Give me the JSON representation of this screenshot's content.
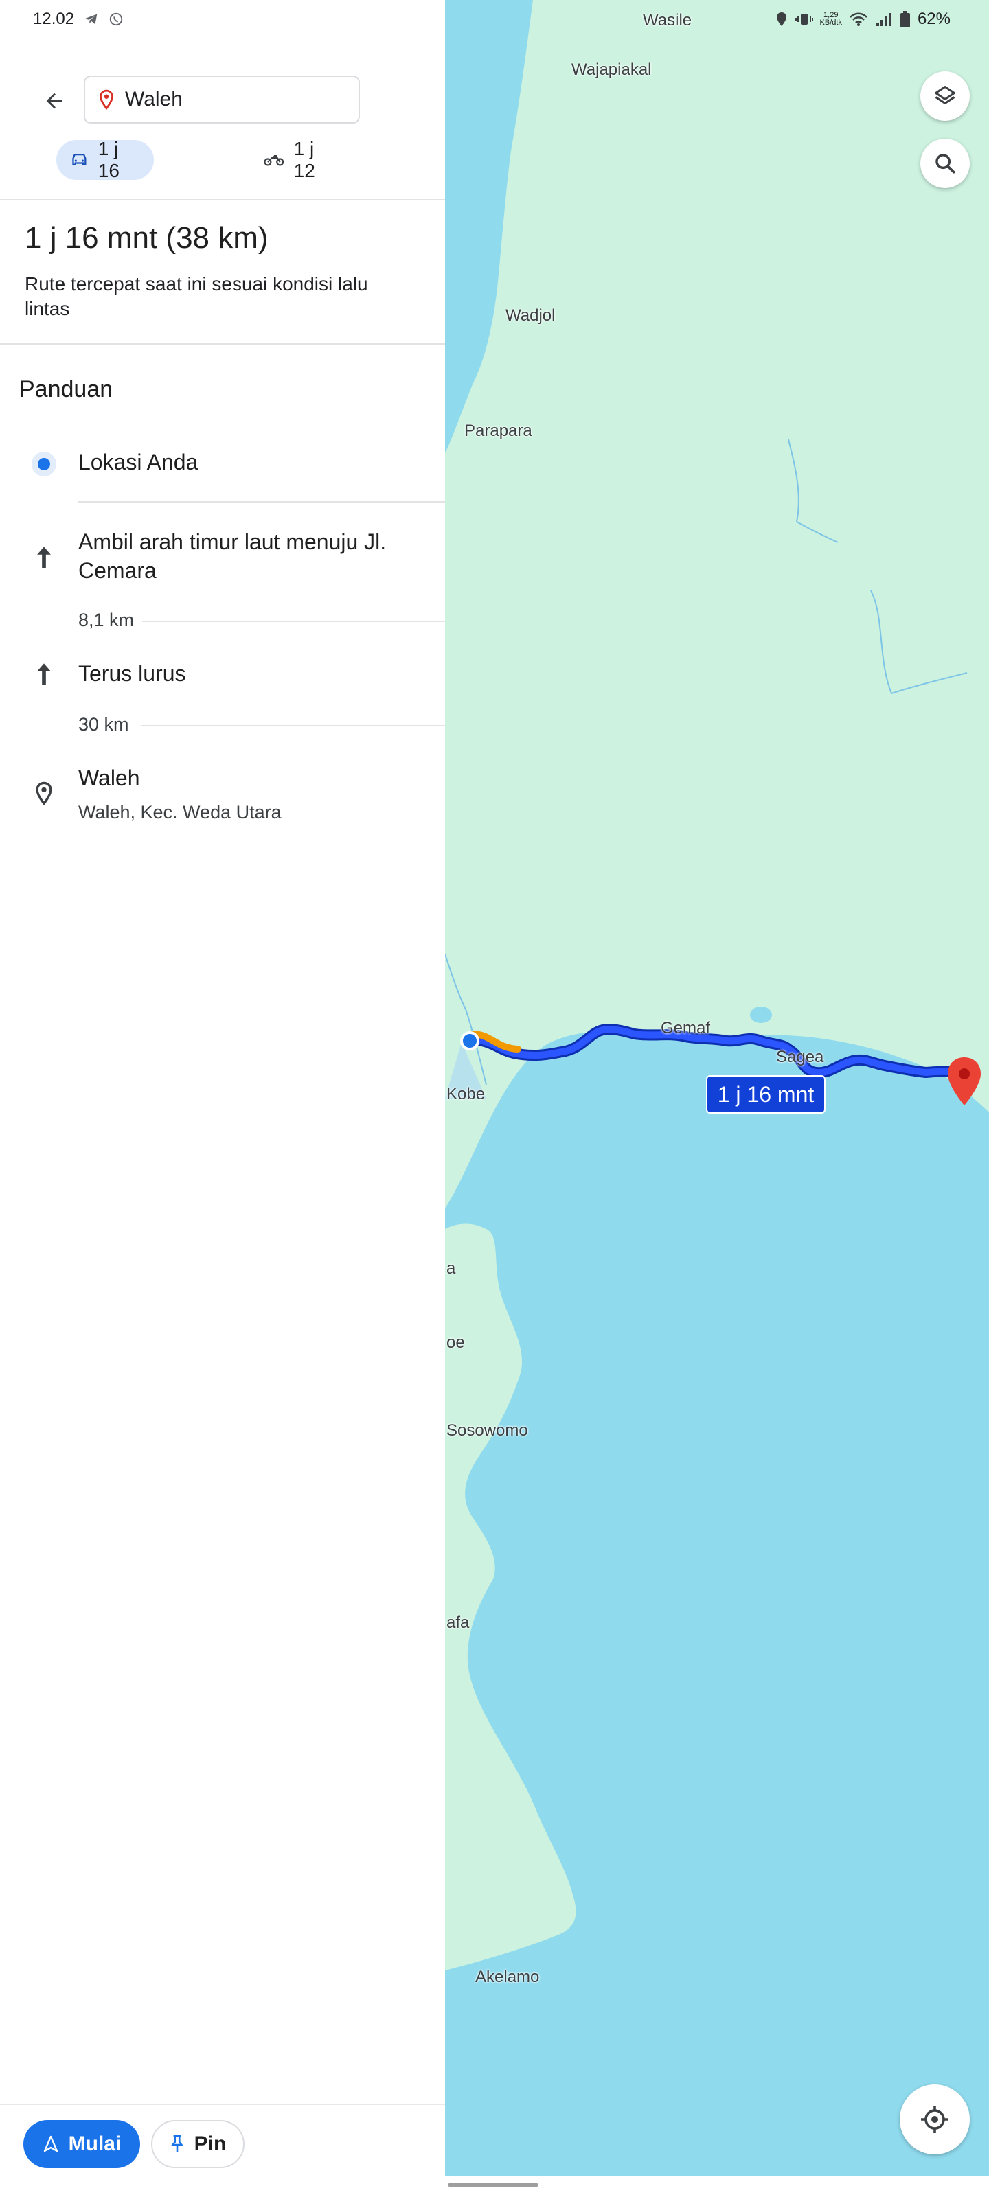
{
  "status_bar": {
    "time": "12.02",
    "network_speed": "1,29\nKB/dtk",
    "battery": "62%"
  },
  "search": {
    "destination": "Waleh"
  },
  "travel_modes": [
    {
      "mode": "car",
      "label": "1 j 16",
      "selected": true
    },
    {
      "mode": "motorcycle",
      "label": "1 j 12",
      "selected": false
    }
  ],
  "summary": {
    "title": "1 j 16 mnt (38 km)",
    "subtitle": "Rute tercepat saat ini sesuai kondisi lalu lintas"
  },
  "guide": {
    "title": "Panduan",
    "steps": [
      {
        "icon": "current-location-icon",
        "text": "Lokasi Anda"
      },
      {
        "icon": "arrow-up-icon",
        "text": "Ambil arah timur laut menuju Jl. Cemara",
        "distance": "8,1 km"
      },
      {
        "icon": "arrow-up-icon",
        "text": "Terus lurus",
        "distance": "30 km"
      },
      {
        "icon": "place-icon",
        "text": "Waleh",
        "subtext": "Waleh, Kec. Weda Utara"
      }
    ]
  },
  "actions": {
    "start": "Mulai",
    "pin": "Pin"
  },
  "map": {
    "labels": {
      "wasile": "Wasile",
      "wajapiakal": "Wajapiakal",
      "wadjol": "Wadjol",
      "parapara": "Parapara",
      "gemaf": "Gemaf",
      "sagea": "Sagea",
      "kobe": "Kobe",
      "a": "a",
      "oe": "oe",
      "sosowomo": "Sosowomo",
      "afa": "afa",
      "akelamo": "Akelamo"
    },
    "route_duration": "1 j 16 mnt",
    "colors": {
      "land": "#cdf2e0",
      "water": "#8fdaed",
      "route": "#1a44e8",
      "traffic": "#f29900",
      "destination_pin": "#ea4335"
    }
  }
}
